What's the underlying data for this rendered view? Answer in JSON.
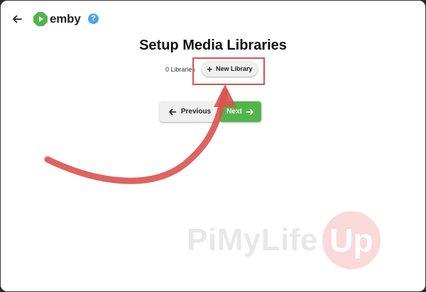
{
  "header": {
    "back_icon": "arrow-left-icon",
    "logo_text": "emby",
    "help_label": "?"
  },
  "main": {
    "title": "Setup Media Libraries",
    "library_count": "0 Libraries",
    "new_library_label": "New Library"
  },
  "footer_buttons": {
    "previous_label": "Previous",
    "next_label": "Next"
  },
  "watermark": {
    "text": "PiMyLife",
    "badge": "Up"
  },
  "colors": {
    "accent_green": "#52b54b",
    "annotation_red": "#d9534f",
    "help_blue": "#4da6e8"
  }
}
